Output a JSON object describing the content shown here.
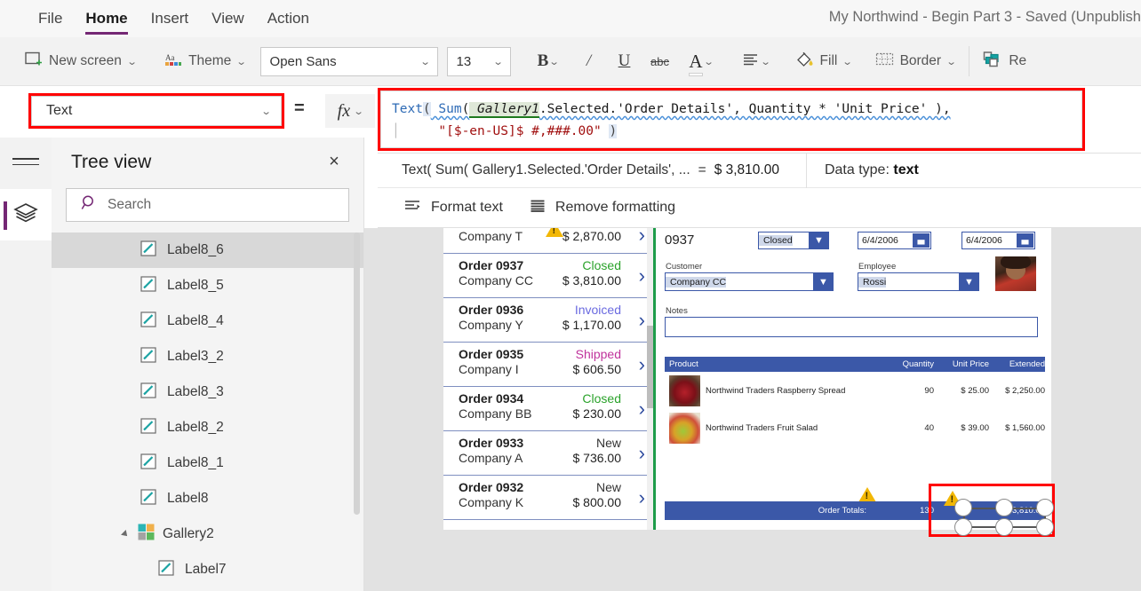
{
  "menu": {
    "items": [
      {
        "label": "File",
        "active": false
      },
      {
        "label": "Home",
        "active": true
      },
      {
        "label": "Insert",
        "active": false
      },
      {
        "label": "View",
        "active": false
      },
      {
        "label": "Action",
        "active": false
      }
    ],
    "app_title": "My Northwind - Begin Part 3 - Saved (Unpublish"
  },
  "ribbon": {
    "new_screen": "New screen",
    "theme": "Theme",
    "font_name": "Open Sans",
    "font_size": "13",
    "bold": "B",
    "italic": "I",
    "underline": "U",
    "strikethrough": "abc",
    "font_color": "A",
    "align": "align-icon",
    "fill": "Fill",
    "border": "Border",
    "reorder": "Re"
  },
  "formula": {
    "property": "Text",
    "equals": "=",
    "fx": "fx",
    "line1_fn": "Text",
    "line1_open": "(",
    "line1_sum": " Sum",
    "line1_sum_open": "(",
    "line1_var": " Gallery1",
    "line1_rest": ".Selected.'Order Details', Quantity * 'Unit Price' ),",
    "line2_str": "\"[$-en-US]$ #,###.00\"",
    "line2_close": ")"
  },
  "result": {
    "expression": "Text( Sum( Gallery1.Selected.'Order Details', ...",
    "equals": "=",
    "value": "$ 3,810.00",
    "datatype_label": "Data type:",
    "datatype_value": "text"
  },
  "format_actions": {
    "format_text": "Format text",
    "remove_formatting": "Remove formatting"
  },
  "tree": {
    "title": "Tree view",
    "close": "×",
    "search_placeholder": "Search",
    "items": [
      {
        "label": "Label8_6",
        "icon": "label-icon",
        "selected": true,
        "indent": 0,
        "type": "label"
      },
      {
        "label": "Label8_5",
        "icon": "label-icon",
        "selected": false,
        "indent": 0,
        "type": "label"
      },
      {
        "label": "Label8_4",
        "icon": "label-icon",
        "selected": false,
        "indent": 0,
        "type": "label"
      },
      {
        "label": "Label3_2",
        "icon": "label-icon",
        "selected": false,
        "indent": 0,
        "type": "label"
      },
      {
        "label": "Label8_3",
        "icon": "label-icon",
        "selected": false,
        "indent": 0,
        "type": "label"
      },
      {
        "label": "Label8_2",
        "icon": "label-icon",
        "selected": false,
        "indent": 0,
        "type": "label"
      },
      {
        "label": "Label8_1",
        "icon": "label-icon",
        "selected": false,
        "indent": 0,
        "type": "label"
      },
      {
        "label": "Label8",
        "icon": "label-icon",
        "selected": false,
        "indent": 0,
        "type": "label"
      },
      {
        "label": "Gallery2",
        "icon": "gallery-icon",
        "selected": false,
        "indent": 0,
        "type": "gallery"
      },
      {
        "label": "Label7",
        "icon": "label-icon",
        "selected": false,
        "indent": 1,
        "type": "label"
      }
    ]
  },
  "canvas": {
    "gallery": {
      "rows": [
        {
          "order": "",
          "status": "",
          "company": "Company T",
          "amount": "$ 2,870.00",
          "status_color": "#333333",
          "clipped": true,
          "warn": true
        },
        {
          "order": "Order 0937",
          "status": "Closed",
          "company": "Company CC",
          "amount": "$ 3,810.00",
          "status_color": "#2aa22a",
          "clipped": false,
          "warn": false
        },
        {
          "order": "Order 0936",
          "status": "Invoiced",
          "company": "Company Y",
          "amount": "$ 1,170.00",
          "status_color": "#6a6ae0",
          "clipped": false,
          "warn": false
        },
        {
          "order": "Order 0935",
          "status": "Shipped",
          "company": "Company I",
          "amount": "$ 606.50",
          "status_color": "#c0339c",
          "clipped": false,
          "warn": false
        },
        {
          "order": "Order 0934",
          "status": "Closed",
          "company": "Company BB",
          "amount": "$ 230.00",
          "status_color": "#2aa22a",
          "clipped": false,
          "warn": false
        },
        {
          "order": "Order 0933",
          "status": "New",
          "company": "Company A",
          "amount": "$ 736.00",
          "status_color": "#333333",
          "clipped": false,
          "warn": false
        },
        {
          "order": "Order 0932",
          "status": "New",
          "company": "Company K",
          "amount": "$ 800.00",
          "status_color": "#333333",
          "clipped": false,
          "warn": false
        }
      ]
    },
    "detail": {
      "order_number": "0937",
      "status_value": "Closed",
      "date1": "6/4/2006",
      "date2": "6/4/2006",
      "customer_label": "Customer",
      "customer_value": "Company CC",
      "employee_label": "Employee",
      "employee_value": "Rossi",
      "notes_label": "Notes",
      "notes_value": "",
      "table": {
        "headers": [
          "Product",
          "Quantity",
          "Unit Price",
          "Extended"
        ],
        "rows": [
          {
            "product": "Northwind Traders Raspberry Spread",
            "quantity": "90",
            "unit_price": "$ 25.00",
            "extended": "$ 2,250.00",
            "thumb": "raspberry"
          },
          {
            "product": "Northwind Traders Fruit Salad",
            "quantity": "40",
            "unit_price": "$ 39.00",
            "extended": "$ 1,560.00",
            "thumb": "fruit"
          }
        ]
      },
      "totals": {
        "label": "Order Totals:",
        "quantity": "130",
        "extended": "$ 3,810.00"
      }
    }
  }
}
